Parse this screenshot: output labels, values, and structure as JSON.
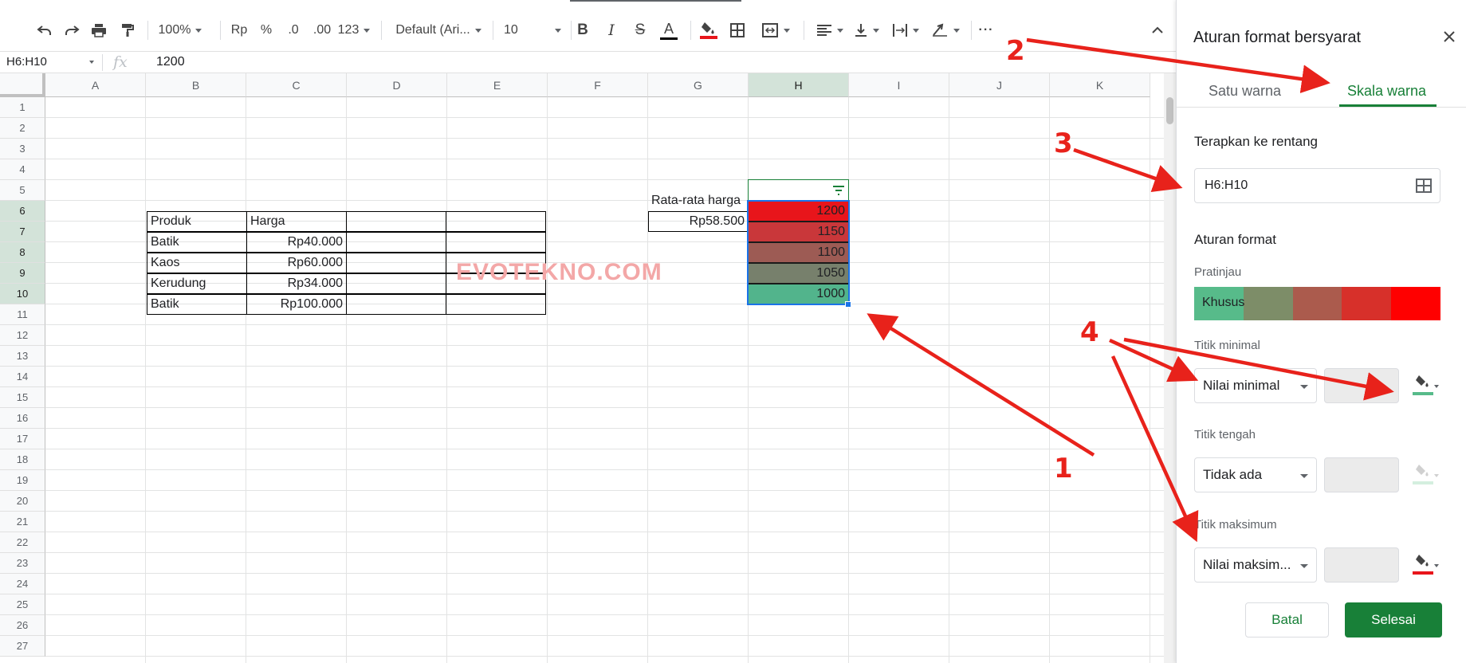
{
  "toolbar": {
    "zoom": "100%",
    "currency": "Rp",
    "percent": "%",
    "decrease_decimal": ".0",
    "increase_decimal": ".00",
    "more_formats": "123",
    "font": "Default (Ari...",
    "font_size": "10",
    "bold": "B",
    "italic": "I",
    "strike": "S",
    "text_color": "A",
    "more": "···",
    "collapse": "^"
  },
  "formula_bar": {
    "name_box": "H6:H10",
    "fx": "fx",
    "value": "1200"
  },
  "grid": {
    "columns": [
      "A",
      "B",
      "C",
      "D",
      "E",
      "F",
      "G",
      "H",
      "I",
      "J",
      "K"
    ],
    "selected_column": "H",
    "rows": [
      "1",
      "2",
      "3",
      "4",
      "5",
      "6",
      "7",
      "8",
      "9",
      "10",
      "11",
      "12",
      "13",
      "14",
      "15",
      "16",
      "17",
      "18",
      "19",
      "20",
      "21",
      "22",
      "23",
      "24",
      "25",
      "26",
      "27"
    ],
    "selected_rows": [
      "6",
      "7",
      "8",
      "9",
      "10"
    ],
    "table": {
      "header": [
        "Produk",
        "Harga"
      ],
      "rows": [
        [
          "Batik",
          "Rp40.000"
        ],
        [
          "Kaos",
          "Rp60.000"
        ],
        [
          "Kerudung",
          "Rp34.000"
        ],
        [
          "Batik",
          "Rp100.000"
        ]
      ]
    },
    "average_label": "Rata-rata harga",
    "average_value": "Rp58.500",
    "filter_icon": "filter-icon",
    "heatmap": [
      {
        "value": "1200",
        "color": "#e8151b"
      },
      {
        "value": "1150",
        "color": "#c9373a"
      },
      {
        "value": "1100",
        "color": "#9d5b54"
      },
      {
        "value": "1050",
        "color": "#77806c"
      },
      {
        "value": "1000",
        "color": "#52b48c"
      }
    ],
    "watermark": "EVOTEKNO.COM"
  },
  "panel": {
    "title": "Aturan format bersyarat",
    "close_icon": "close-icon",
    "tabs": [
      {
        "label": "Satu warna",
        "active": false
      },
      {
        "label": "Skala warna",
        "active": true
      }
    ],
    "apply_range_label": "Terapkan ke rentang",
    "range_value": "H6:H10",
    "format_rules_label": "Aturan format",
    "preview_label": "Pratinjau",
    "preview_text": "Khusus",
    "preview_colors": [
      "#57bb8a",
      "#7d8d68",
      "#ab5b4d",
      "#d7302a",
      "#ff0000"
    ],
    "min_point": {
      "label": "Titik minimal",
      "dropdown": "Nilai minimal",
      "color": "#57bb8a"
    },
    "mid_point": {
      "label": "Titik tengah",
      "dropdown": "Tidak ada",
      "color": "#d4efdf"
    },
    "max_point": {
      "label": "Titik maksimum",
      "dropdown": "Nilai maksim...",
      "color": "#e8151b"
    },
    "cancel": "Batal",
    "done": "Selesai"
  },
  "annotations": {
    "color": "#e8221b",
    "labels": [
      "1",
      "2",
      "3",
      "4"
    ]
  }
}
